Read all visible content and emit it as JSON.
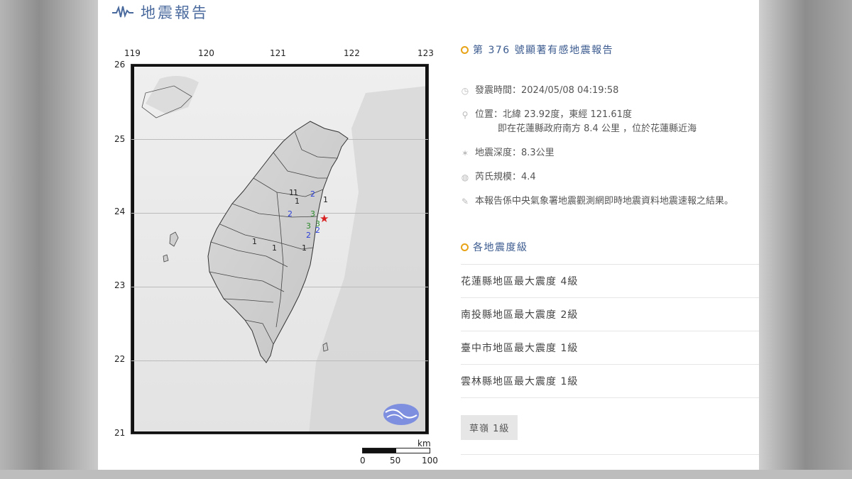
{
  "header": {
    "title": "地震報告"
  },
  "map": {
    "top_ticks": [
      "119",
      "120",
      "121",
      "122",
      "123"
    ],
    "left_ticks": [
      "26",
      "25",
      "24",
      "23",
      "22",
      "21"
    ],
    "scale_unit": "km",
    "scale_ticks": [
      "0",
      "50",
      "100"
    ],
    "intensity_marks": [
      {
        "label": "1",
        "color": "#222222"
      },
      {
        "label": "1",
        "color": "#222222"
      },
      {
        "label": "2",
        "color": "#2b3fd8"
      },
      {
        "label": "1",
        "color": "#222222"
      },
      {
        "label": "1",
        "color": "#222222"
      },
      {
        "label": "2",
        "color": "#2b3fd8"
      },
      {
        "label": "3",
        "color": "#2e8b2e"
      },
      {
        "label": "3",
        "color": "#2e8b2e"
      },
      {
        "label": "3",
        "color": "#2e8b2e"
      },
      {
        "label": "2",
        "color": "#2b3fd8"
      },
      {
        "label": "2",
        "color": "#2b3fd8"
      },
      {
        "label": "1",
        "color": "#222222"
      },
      {
        "label": "1",
        "color": "#222222"
      },
      {
        "label": "1",
        "color": "#222222"
      }
    ],
    "epicenter_color": "#d92020"
  },
  "report": {
    "title": "第 376 號顯著有感地震報告",
    "time": "發震時間：2024/05/08 04:19:58",
    "location_line1": "位置：北緯 23.92度，東經 121.61度",
    "location_line2": "即在花蓮縣政府南方 8.4 公里 ，位於花蓮縣近海",
    "depth": "地震深度：8.3公里",
    "magnitude": "芮氏規模：4.4",
    "note": "本報告係中央氣象署地震觀測網即時地震資料地震速報之結果。",
    "section_title": "各地震度級",
    "intensity_rows": [
      "花蓮縣地區最大震度 4級",
      "南投縣地區最大震度 2級",
      "臺中市地區最大震度 1級",
      "雲林縣地區最大震度 1級"
    ],
    "chip": "草嶺 1級"
  },
  "colors": {
    "accent": "#3c5b8f",
    "dot": "#e8a317"
  }
}
